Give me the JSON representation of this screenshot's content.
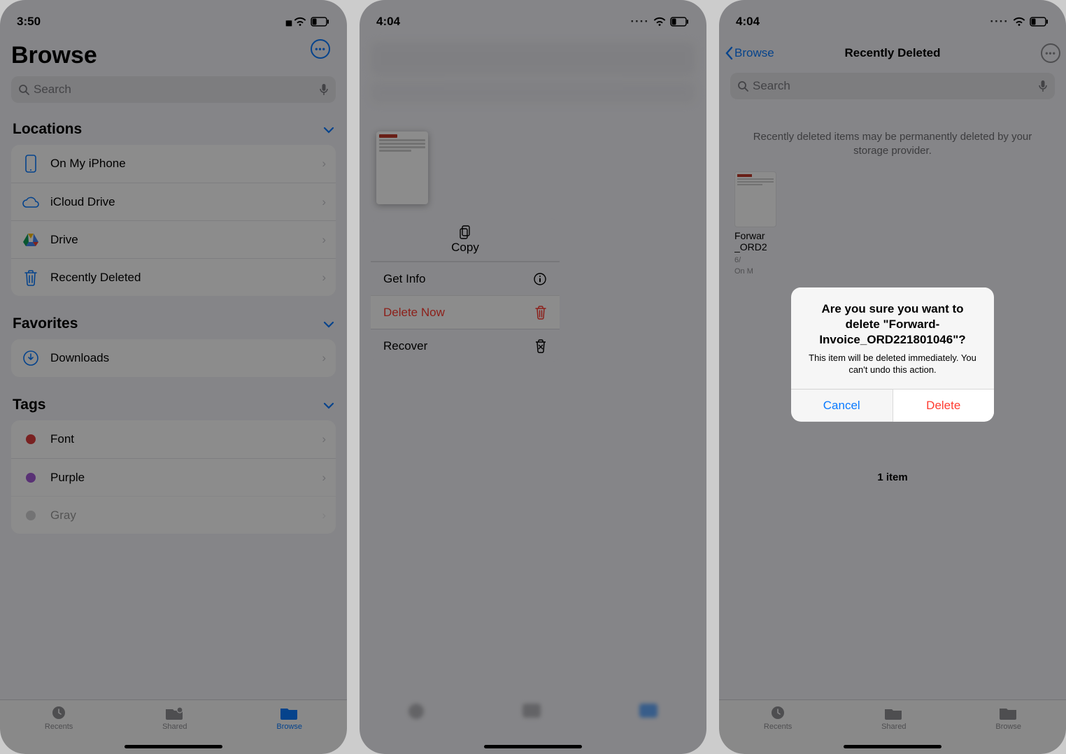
{
  "phone1": {
    "time": "3:50",
    "battery": "27",
    "title": "Browse",
    "search_placeholder": "Search",
    "sections": {
      "locations": {
        "heading": "Locations",
        "items": [
          "On My iPhone",
          "iCloud Drive",
          "Drive",
          "Recently Deleted"
        ]
      },
      "favorites": {
        "heading": "Favorites",
        "items": [
          "Downloads"
        ]
      },
      "tags": {
        "heading": "Tags",
        "items": [
          "Font",
          "Purple",
          "Gray"
        ]
      }
    },
    "tabs": {
      "recents": "Recents",
      "shared": "Shared",
      "browse": "Browse"
    }
  },
  "phone2": {
    "time": "4:04",
    "battery": "26",
    "context": {
      "copy": "Copy",
      "get_info": "Get Info",
      "delete_now": "Delete Now",
      "recover": "Recover"
    }
  },
  "phone3": {
    "time": "4:04",
    "battery": "26",
    "nav": {
      "back": "Browse",
      "title": "Recently Deleted"
    },
    "search_placeholder": "Search",
    "info": "Recently deleted items may be permanently deleted by your storage provider.",
    "file": {
      "name_line1": "Forwar",
      "name_line2": "_ORD2",
      "date": "6/",
      "loc": "On M"
    },
    "alert": {
      "title": "Are you sure you want to delete \"Forward-Invoice_ORD221801046\"?",
      "message": "This item will be deleted immediately. You can't undo this action.",
      "cancel": "Cancel",
      "delete": "Delete"
    },
    "count": "1 item",
    "tabs": {
      "recents": "Recents",
      "shared": "Shared",
      "browse": "Browse"
    }
  }
}
